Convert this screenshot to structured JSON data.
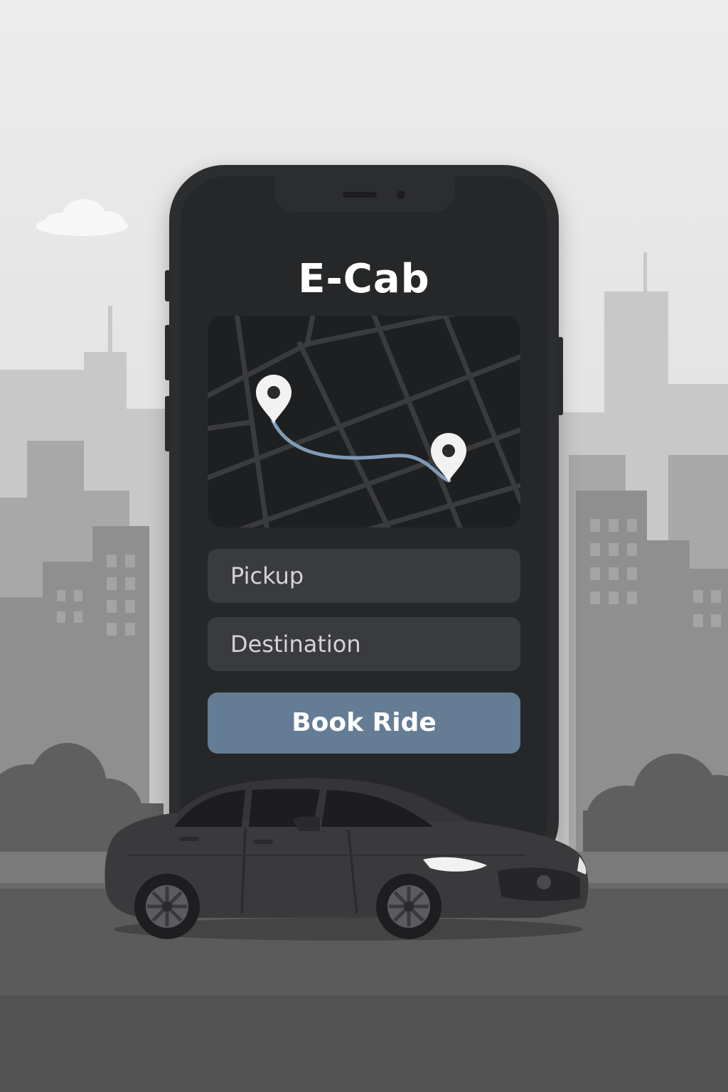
{
  "app": {
    "title": "E-Cab"
  },
  "form": {
    "pickup_placeholder": "Pickup",
    "destination_placeholder": "Destination",
    "book_label": "Book Ride"
  },
  "map": {
    "pins": [
      "location-pin-icon",
      "location-pin-icon"
    ]
  },
  "colors": {
    "accent": "#647c94",
    "route": "#7f9bb8",
    "phone_body": "#2c2d2f",
    "screen": "#262729",
    "field": "#3a3b3e"
  }
}
